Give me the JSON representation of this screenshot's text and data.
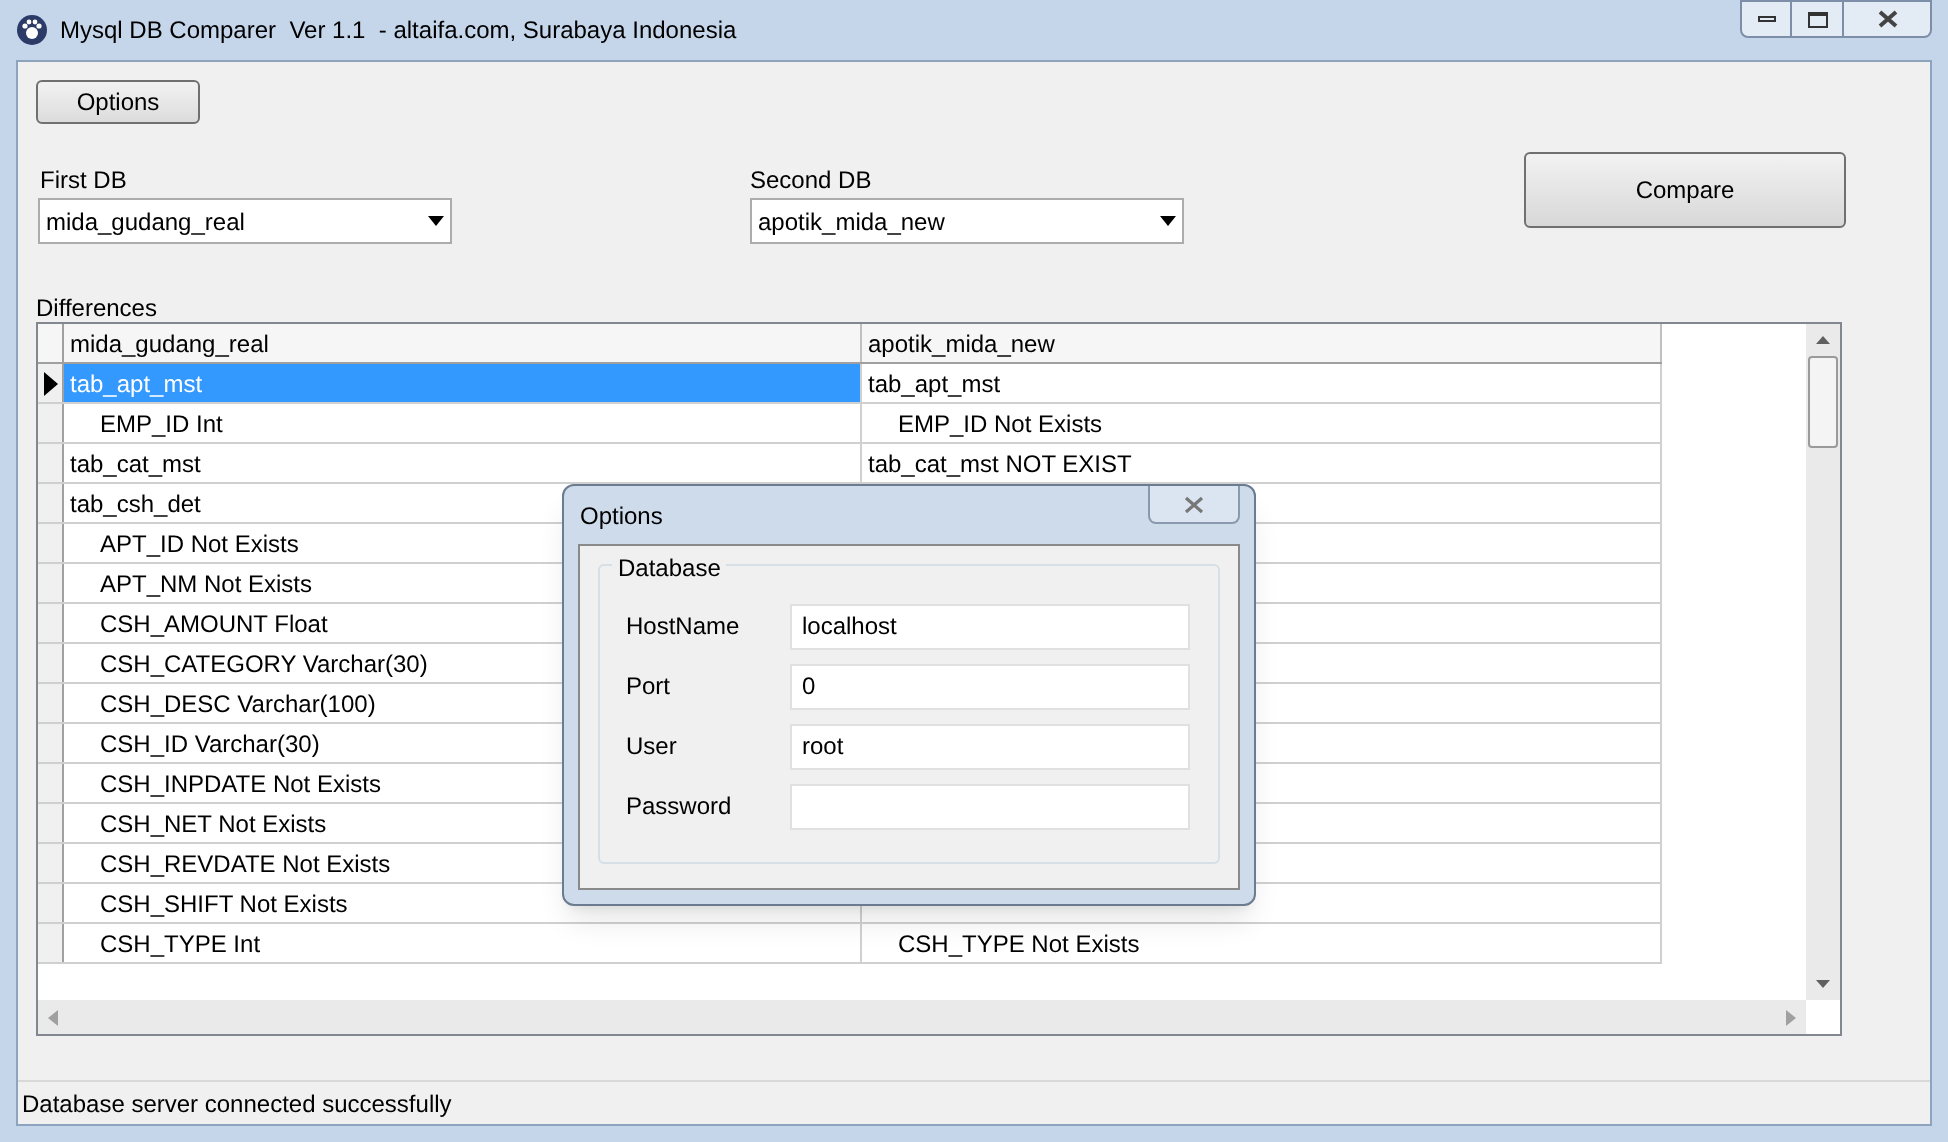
{
  "window": {
    "title": "Mysql DB Comparer  Ver 1.1  - altaifa.com, Surabaya Indonesia"
  },
  "toolbar": {
    "options_button": "Options"
  },
  "first_db": {
    "label": "First DB",
    "value": "mida_gudang_real"
  },
  "second_db": {
    "label": "Second DB",
    "value": "apotik_mida_new"
  },
  "compare_button": "Compare",
  "differences": {
    "label": "Differences",
    "columns": [
      "mida_gudang_real",
      "apotik_mida_new"
    ],
    "rows": [
      {
        "left": "tab_apt_mst",
        "right": "tab_apt_mst",
        "selected": true,
        "children": [
          {
            "left": "EMP_ID Int",
            "right": "EMP_ID Not Exists"
          }
        ]
      },
      {
        "left": "tab_cat_mst",
        "right": "tab_cat_mst NOT EXIST",
        "selected": false,
        "children": []
      },
      {
        "left": "tab_csh_det",
        "selected": false,
        "children": [
          {
            "left": "APT_ID Not Exists"
          },
          {
            "left": "APT_NM Not Exists"
          },
          {
            "left": "CSH_AMOUNT Float"
          },
          {
            "left": "CSH_CATEGORY Varchar(30)"
          },
          {
            "left": "CSH_DESC Varchar(100)"
          },
          {
            "left": "CSH_ID Varchar(30)"
          },
          {
            "left": "CSH_INPDATE Not Exists"
          },
          {
            "left": "CSH_NET Not Exists"
          },
          {
            "left": "CSH_REVDATE Not Exists"
          },
          {
            "left": "CSH_SHIFT Not Exists"
          },
          {
            "left": "CSH_TYPE Int",
            "right": "CSH_TYPE Not Exists"
          }
        ]
      }
    ]
  },
  "status_bar": "Database server connected successfully",
  "options_dialog": {
    "title": "Options",
    "group": "Database",
    "fields": [
      {
        "label": "HostName",
        "value": "localhost"
      },
      {
        "label": "Port",
        "value": "0"
      },
      {
        "label": "User",
        "value": "root"
      },
      {
        "label": "Password"
      }
    ]
  }
}
